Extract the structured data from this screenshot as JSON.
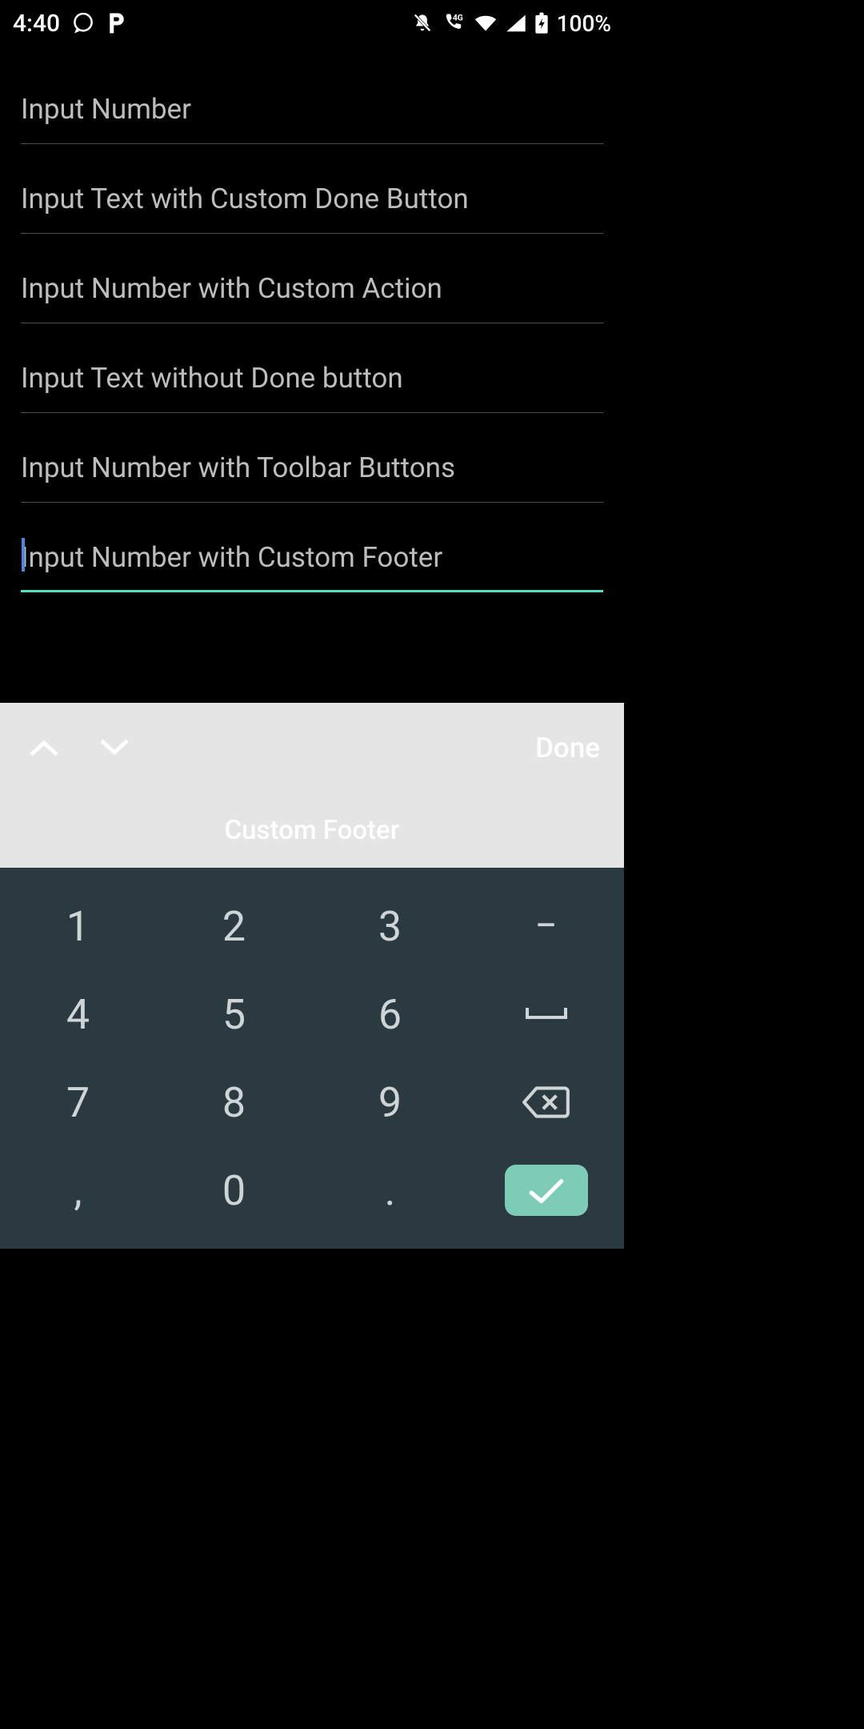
{
  "status": {
    "time": "4:40",
    "battery": "100%"
  },
  "inputs": [
    {
      "placeholder": "Input Number",
      "active": false
    },
    {
      "placeholder": "Input Text with Custom Done Button",
      "active": false
    },
    {
      "placeholder": "Input Number with Custom Action",
      "active": false
    },
    {
      "placeholder": "Input Text without Done button",
      "active": false
    },
    {
      "placeholder": "Input Number with Toolbar Buttons",
      "active": false
    },
    {
      "placeholder": "Input Number with Custom Footer",
      "active": true
    }
  ],
  "accessory": {
    "done_label": "Done",
    "footer_label": "Custom Footer"
  },
  "keypad": {
    "keys": [
      [
        "1",
        "2",
        "3",
        "−"
      ],
      [
        "4",
        "5",
        "6",
        "space"
      ],
      [
        "7",
        "8",
        "9",
        "backspace"
      ],
      [
        ",",
        "0",
        ".",
        "enter"
      ]
    ]
  }
}
